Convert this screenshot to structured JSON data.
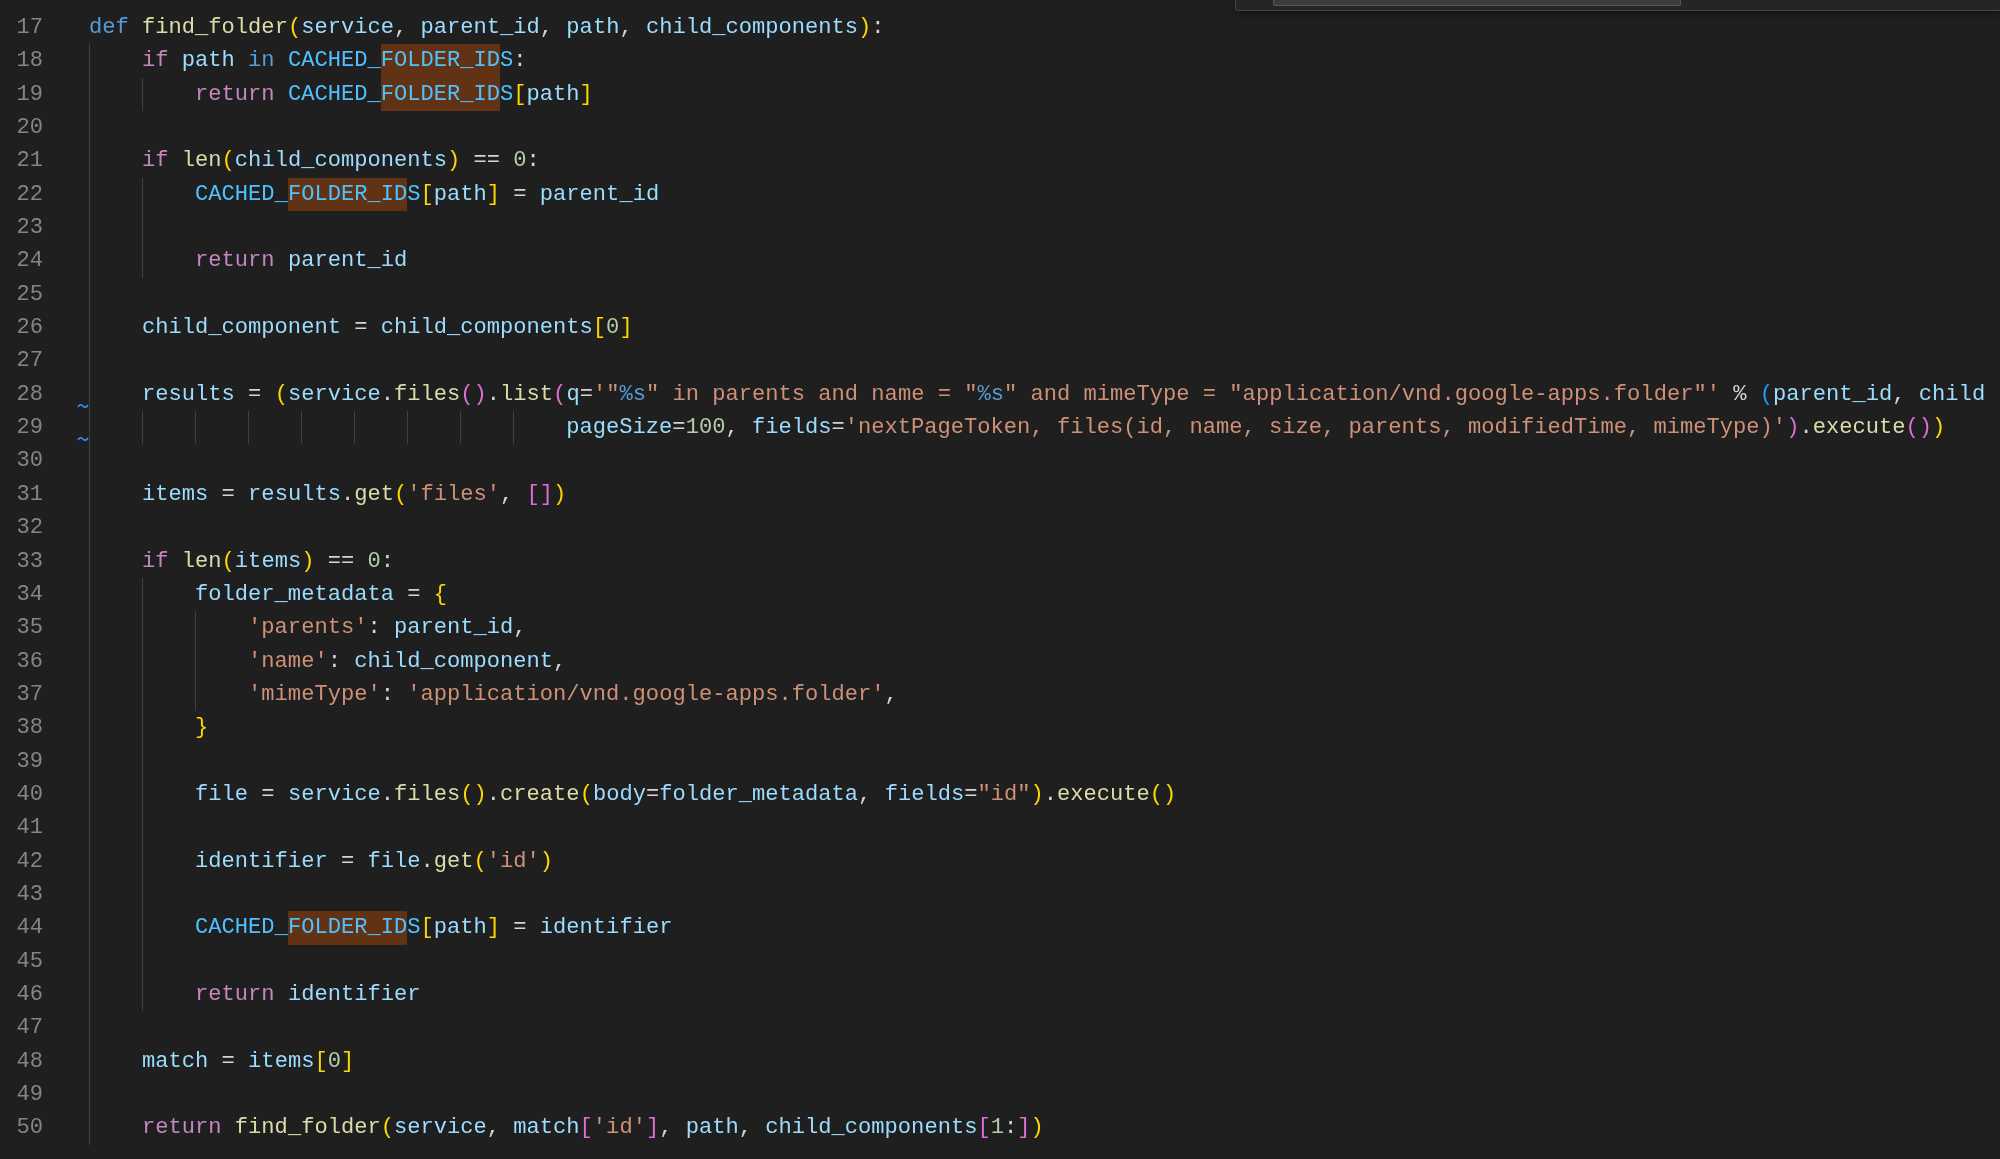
{
  "editor": {
    "lines": [
      {
        "number": "17",
        "marked": false,
        "tokens": [
          {
            "t": "def ",
            "kind": "def"
          },
          {
            "t": "find_folder",
            "kind": "fn"
          },
          {
            "t": "(",
            "kind": "p1"
          },
          {
            "t": "service",
            "kind": "var"
          },
          {
            "t": ", ",
            "kind": "op"
          },
          {
            "t": "parent_id",
            "kind": "var"
          },
          {
            "t": ", ",
            "kind": "op"
          },
          {
            "t": "path",
            "kind": "var"
          },
          {
            "t": ", ",
            "kind": "op"
          },
          {
            "t": "child_components",
            "kind": "var"
          },
          {
            "t": ")",
            "kind": "p1"
          },
          {
            "t": ":",
            "kind": "op"
          }
        ]
      },
      {
        "number": "18",
        "marked": false,
        "tokens": [
          {
            "t": "    if ",
            "kind": "kw"
          },
          {
            "t": "path ",
            "kind": "var"
          },
          {
            "t": "in ",
            "kind": "def"
          },
          {
            "t": "CACHED_",
            "kind": "const"
          },
          {
            "t": "FOLDER_ID",
            "kind": "match"
          },
          {
            "t": "S",
            "kind": "const"
          },
          {
            "t": ":",
            "kind": "op"
          }
        ]
      },
      {
        "number": "19",
        "marked": false,
        "tokens": [
          {
            "t": "        return ",
            "kind": "kw"
          },
          {
            "t": "CACHED_",
            "kind": "const"
          },
          {
            "t": "FOLDER_ID",
            "kind": "match"
          },
          {
            "t": "S",
            "kind": "const"
          },
          {
            "t": "[",
            "kind": "p1"
          },
          {
            "t": "path",
            "kind": "var"
          },
          {
            "t": "]",
            "kind": "p1"
          }
        ]
      },
      {
        "number": "20",
        "marked": false
      },
      {
        "number": "21",
        "marked": false,
        "tokens": [
          {
            "t": "    if ",
            "kind": "kw"
          },
          {
            "t": "len",
            "kind": "fn"
          },
          {
            "t": "(",
            "kind": "p1"
          },
          {
            "t": "child_components",
            "kind": "var"
          },
          {
            "t": ")",
            "kind": "p1"
          },
          {
            "t": " == ",
            "kind": "op"
          },
          {
            "t": "0",
            "kind": "num"
          },
          {
            "t": ":",
            "kind": "op"
          }
        ]
      },
      {
        "number": "22",
        "marked": false,
        "tokens": [
          {
            "t": "        CACHED_",
            "kind": "const"
          },
          {
            "t": "FOLDER_ID",
            "kind": "match"
          },
          {
            "t": "S",
            "kind": "const"
          },
          {
            "t": "[",
            "kind": "p1"
          },
          {
            "t": "path",
            "kind": "var"
          },
          {
            "t": "]",
            "kind": "p1"
          },
          {
            "t": " = ",
            "kind": "op"
          },
          {
            "t": "parent_id",
            "kind": "var"
          }
        ]
      },
      {
        "number": "23",
        "marked": false
      },
      {
        "number": "24",
        "marked": false,
        "tokens": [
          {
            "t": "        return ",
            "kind": "kw"
          },
          {
            "t": "parent_id",
            "kind": "var"
          }
        ]
      },
      {
        "number": "25",
        "marked": false
      },
      {
        "number": "26",
        "marked": false,
        "tokens": [
          {
            "t": "    child_component",
            "kind": "var"
          },
          {
            "t": " = ",
            "kind": "op"
          },
          {
            "t": "child_components",
            "kind": "var"
          },
          {
            "t": "[",
            "kind": "p1"
          },
          {
            "t": "0",
            "kind": "num"
          },
          {
            "t": "]",
            "kind": "p1"
          }
        ]
      },
      {
        "number": "27",
        "marked": false
      },
      {
        "number": "28",
        "marked": true,
        "tokens": [
          {
            "t": "    results",
            "kind": "var"
          },
          {
            "t": " = ",
            "kind": "op"
          },
          {
            "t": "(",
            "kind": "p1"
          },
          {
            "t": "service",
            "kind": "var"
          },
          {
            "t": ".",
            "kind": "op"
          },
          {
            "t": "files",
            "kind": "fn"
          },
          {
            "t": "()",
            "kind": "p2"
          },
          {
            "t": ".",
            "kind": "op"
          },
          {
            "t": "list",
            "kind": "fn"
          },
          {
            "t": "(",
            "kind": "p2"
          },
          {
            "t": "q",
            "kind": "var"
          },
          {
            "t": "=",
            "kind": "op"
          },
          {
            "t": "'\"",
            "kind": "str"
          },
          {
            "t": "%s",
            "kind": "fmt"
          },
          {
            "t": "\" in parents and name = \"",
            "kind": "str"
          },
          {
            "t": "%s",
            "kind": "fmt"
          },
          {
            "t": "\" and mimeType = \"application/vnd.google-apps.folder\"'",
            "kind": "str"
          },
          {
            "t": " % ",
            "kind": "op"
          },
          {
            "t": "(",
            "kind": "p3"
          },
          {
            "t": "parent_id",
            "kind": "var"
          },
          {
            "t": ", ",
            "kind": "op"
          },
          {
            "t": "child",
            "kind": "var"
          }
        ]
      },
      {
        "number": "29",
        "marked": true,
        "tokens": [
          {
            "t": "                                    pageSize",
            "kind": "var"
          },
          {
            "t": "=",
            "kind": "op"
          },
          {
            "t": "100",
            "kind": "num"
          },
          {
            "t": ", ",
            "kind": "op"
          },
          {
            "t": "fields",
            "kind": "var"
          },
          {
            "t": "=",
            "kind": "op"
          },
          {
            "t": "'nextPageToken, files(id, name, size, parents, modifiedTime, mimeType)'",
            "kind": "str"
          },
          {
            "t": ")",
            "kind": "p2"
          },
          {
            "t": ".",
            "kind": "op"
          },
          {
            "t": "execute",
            "kind": "fn"
          },
          {
            "t": "()",
            "kind": "p2"
          },
          {
            "t": ")",
            "kind": "p1"
          }
        ]
      },
      {
        "number": "30",
        "marked": false
      },
      {
        "number": "31",
        "marked": false,
        "tokens": [
          {
            "t": "    items",
            "kind": "var"
          },
          {
            "t": " = ",
            "kind": "op"
          },
          {
            "t": "results",
            "kind": "var"
          },
          {
            "t": ".",
            "kind": "op"
          },
          {
            "t": "get",
            "kind": "fn"
          },
          {
            "t": "(",
            "kind": "p1"
          },
          {
            "t": "'files'",
            "kind": "str"
          },
          {
            "t": ", ",
            "kind": "op"
          },
          {
            "t": "[]",
            "kind": "p2"
          },
          {
            "t": ")",
            "kind": "p1"
          }
        ]
      },
      {
        "number": "32",
        "marked": false
      },
      {
        "number": "33",
        "marked": false,
        "tokens": [
          {
            "t": "    if ",
            "kind": "kw"
          },
          {
            "t": "len",
            "kind": "fn"
          },
          {
            "t": "(",
            "kind": "p1"
          },
          {
            "t": "items",
            "kind": "var"
          },
          {
            "t": ")",
            "kind": "p1"
          },
          {
            "t": " == ",
            "kind": "op"
          },
          {
            "t": "0",
            "kind": "num"
          },
          {
            "t": ":",
            "kind": "op"
          }
        ]
      },
      {
        "number": "34",
        "marked": false,
        "tokens": [
          {
            "t": "        folder_metadata",
            "kind": "var"
          },
          {
            "t": " = ",
            "kind": "op"
          },
          {
            "t": "{",
            "kind": "p1"
          }
        ]
      },
      {
        "number": "35",
        "marked": false,
        "tokens": [
          {
            "t": "            'parents'",
            "kind": "str"
          },
          {
            "t": ": ",
            "kind": "op"
          },
          {
            "t": "parent_id",
            "kind": "var"
          },
          {
            "t": ",",
            "kind": "op"
          }
        ]
      },
      {
        "number": "36",
        "marked": false,
        "tokens": [
          {
            "t": "            'name'",
            "kind": "str"
          },
          {
            "t": ": ",
            "kind": "op"
          },
          {
            "t": "child_component",
            "kind": "var"
          },
          {
            "t": ",",
            "kind": "op"
          }
        ]
      },
      {
        "number": "37",
        "marked": false,
        "tokens": [
          {
            "t": "            'mimeType'",
            "kind": "str"
          },
          {
            "t": ": ",
            "kind": "op"
          },
          {
            "t": "'application/vnd.google-apps.folder'",
            "kind": "str"
          },
          {
            "t": ",",
            "kind": "op"
          }
        ]
      },
      {
        "number": "38",
        "marked": false,
        "tokens": [
          {
            "t": "        }",
            "kind": "p1"
          }
        ]
      },
      {
        "number": "39",
        "marked": false
      },
      {
        "number": "40",
        "marked": false,
        "tokens": [
          {
            "t": "        file",
            "kind": "var"
          },
          {
            "t": " = ",
            "kind": "op"
          },
          {
            "t": "service",
            "kind": "var"
          },
          {
            "t": ".",
            "kind": "op"
          },
          {
            "t": "files",
            "kind": "fn"
          },
          {
            "t": "()",
            "kind": "p1"
          },
          {
            "t": ".",
            "kind": "op"
          },
          {
            "t": "create",
            "kind": "fn"
          },
          {
            "t": "(",
            "kind": "p1"
          },
          {
            "t": "body",
            "kind": "var"
          },
          {
            "t": "=",
            "kind": "op"
          },
          {
            "t": "folder_metadata",
            "kind": "var"
          },
          {
            "t": ", ",
            "kind": "op"
          },
          {
            "t": "fields",
            "kind": "var"
          },
          {
            "t": "=",
            "kind": "op"
          },
          {
            "t": "\"id\"",
            "kind": "str"
          },
          {
            "t": ")",
            "kind": "p1"
          },
          {
            "t": ".",
            "kind": "op"
          },
          {
            "t": "execute",
            "kind": "fn"
          },
          {
            "t": "()",
            "kind": "p1"
          }
        ]
      },
      {
        "number": "41",
        "marked": false
      },
      {
        "number": "42",
        "marked": false,
        "tokens": [
          {
            "t": "        identifier",
            "kind": "var"
          },
          {
            "t": " = ",
            "kind": "op"
          },
          {
            "t": "file",
            "kind": "var"
          },
          {
            "t": ".",
            "kind": "op"
          },
          {
            "t": "get",
            "kind": "fn"
          },
          {
            "t": "(",
            "kind": "p1"
          },
          {
            "t": "'id'",
            "kind": "str"
          },
          {
            "t": ")",
            "kind": "p1"
          }
        ]
      },
      {
        "number": "43",
        "marked": false
      },
      {
        "number": "44",
        "marked": false,
        "tokens": [
          {
            "t": "        CACHED_",
            "kind": "const"
          },
          {
            "t": "FOLDER_ID",
            "kind": "match"
          },
          {
            "t": "S",
            "kind": "const"
          },
          {
            "t": "[",
            "kind": "p1"
          },
          {
            "t": "path",
            "kind": "var"
          },
          {
            "t": "]",
            "kind": "p1"
          },
          {
            "t": " = ",
            "kind": "op"
          },
          {
            "t": "identifier",
            "kind": "var"
          }
        ]
      },
      {
        "number": "45",
        "marked": false
      },
      {
        "number": "46",
        "marked": false,
        "tokens": [
          {
            "t": "        return ",
            "kind": "kw"
          },
          {
            "t": "identifier",
            "kind": "var"
          }
        ]
      },
      {
        "number": "47",
        "marked": false
      },
      {
        "number": "48",
        "marked": false,
        "tokens": [
          {
            "t": "    match",
            "kind": "var"
          },
          {
            "t": " = ",
            "kind": "op"
          },
          {
            "t": "items",
            "kind": "var"
          },
          {
            "t": "[",
            "kind": "p1"
          },
          {
            "t": "0",
            "kind": "num"
          },
          {
            "t": "]",
            "kind": "p1"
          }
        ]
      },
      {
        "number": "49",
        "marked": false
      },
      {
        "number": "50",
        "marked": false,
        "tokens": [
          {
            "t": "    return ",
            "kind": "kw"
          },
          {
            "t": "find_folder",
            "kind": "fn"
          },
          {
            "t": "(",
            "kind": "p1"
          },
          {
            "t": "service",
            "kind": "var"
          },
          {
            "t": ", ",
            "kind": "op"
          },
          {
            "t": "match",
            "kind": "var"
          },
          {
            "t": "[",
            "kind": "p2"
          },
          {
            "t": "'id'",
            "kind": "str"
          },
          {
            "t": "]",
            "kind": "p2"
          },
          {
            "t": ", ",
            "kind": "op"
          },
          {
            "t": "path",
            "kind": "var"
          },
          {
            "t": ", ",
            "kind": "op"
          },
          {
            "t": "child_components",
            "kind": "var"
          },
          {
            "t": "[",
            "kind": "p2"
          },
          {
            "t": "1",
            "kind": "num"
          },
          {
            "t": ":",
            "kind": "op"
          },
          {
            "t": "]",
            "kind": "p2"
          },
          {
            "t": ")",
            "kind": "p1"
          }
        ]
      }
    ]
  }
}
